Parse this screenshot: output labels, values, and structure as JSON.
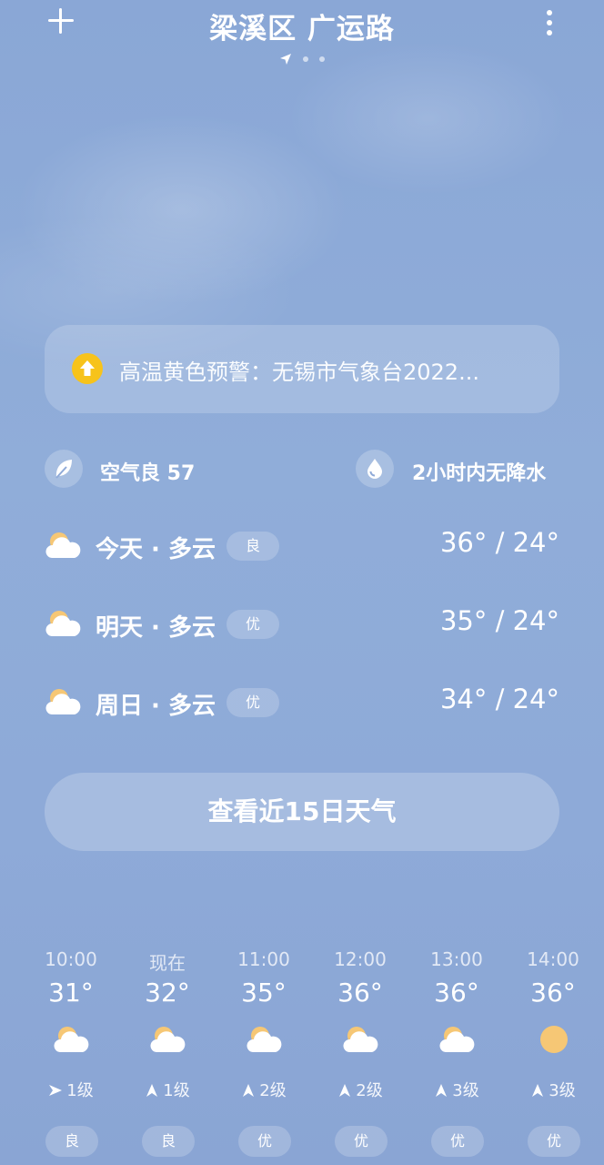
{
  "header": {
    "title": "梁溪区 广运路"
  },
  "alert": {
    "text": "高温黄色预警：无锡市气象台2022...",
    "icon": "up-arrow-circle-icon",
    "color": "#f7c31b"
  },
  "air_quality": {
    "label": "空气良 57",
    "icon": "leaf-icon"
  },
  "precipitation": {
    "label": "2小时内无降水",
    "icon": "water-drop-icon"
  },
  "forecast": [
    {
      "label": "今天 · 多云",
      "aqi": "良",
      "temp": "36° / 24°",
      "icon": "partly-cloudy-icon"
    },
    {
      "label": "明天 · 多云",
      "aqi": "优",
      "temp": "35° / 24°",
      "icon": "partly-cloudy-icon"
    },
    {
      "label": "周日 · 多云",
      "aqi": "优",
      "temp": "34° / 24°",
      "icon": "partly-cloudy-icon"
    }
  ],
  "forecast_button": "查看近15日天气",
  "hourly": [
    {
      "time": "10:00",
      "temp": "31°",
      "icon": "partly-cloudy-icon",
      "wind": "1级",
      "aqi": "良"
    },
    {
      "time": "现在",
      "temp": "32°",
      "icon": "partly-cloudy-icon",
      "wind": "1级",
      "aqi": "良"
    },
    {
      "time": "11:00",
      "temp": "35°",
      "icon": "partly-cloudy-icon",
      "wind": "2级",
      "aqi": "优"
    },
    {
      "time": "12:00",
      "temp": "36°",
      "icon": "partly-cloudy-icon",
      "wind": "2级",
      "aqi": "优"
    },
    {
      "time": "13:00",
      "temp": "36°",
      "icon": "partly-cloudy-icon",
      "wind": "3级",
      "aqi": "优"
    },
    {
      "time": "14:00",
      "temp": "36°",
      "icon": "sunny-icon",
      "wind": "3级",
      "aqi": "优"
    }
  ]
}
